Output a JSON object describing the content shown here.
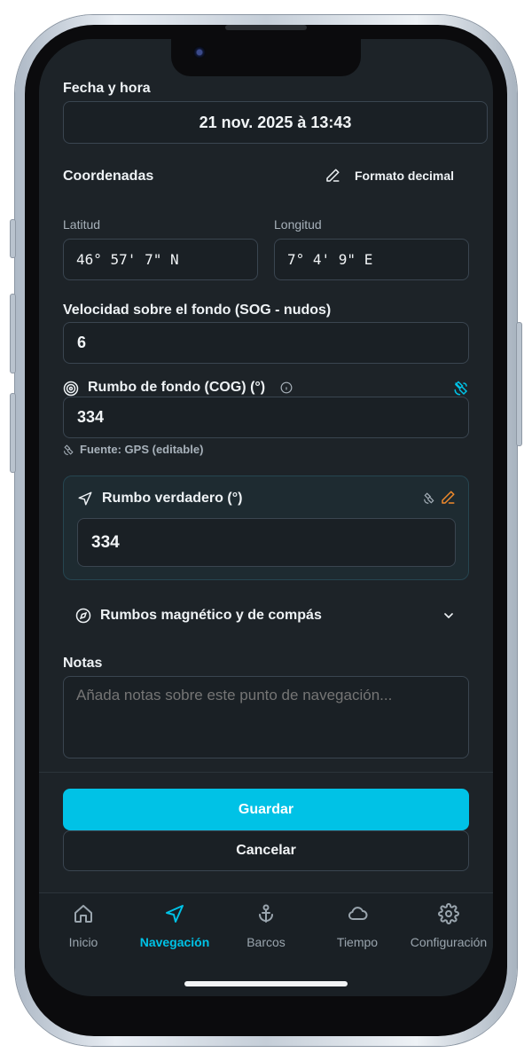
{
  "fecha": {
    "label": "Fecha y hora",
    "value": "21 nov. 2025 à 13:43"
  },
  "coords": {
    "label": "Coordenadas",
    "format_button": "Formato decimal",
    "lat_label": "Latitud",
    "lat_value": "46° 57' 7\" N",
    "lon_label": "Longitud",
    "lon_value": "7° 4' 9\" E"
  },
  "sog": {
    "label": "Velocidad sobre el fondo (SOG - nudos)",
    "value": "6"
  },
  "cog": {
    "label": "Rumbo de fondo (COG) (°)",
    "value": "334",
    "source": "Fuente: GPS (editable)"
  },
  "true_heading": {
    "label": "Rumbo verdadero (°)",
    "value": "334"
  },
  "magnetic": {
    "label": "Rumbos magnético y de compás"
  },
  "notes": {
    "label": "Notas",
    "placeholder": "Añada notas sobre este punto de navegación..."
  },
  "actions": {
    "save": "Guardar",
    "cancel": "Cancelar"
  },
  "bottom_nav": [
    {
      "label": "Inicio",
      "icon": "home-icon"
    },
    {
      "label": "Navegación",
      "icon": "navigation-icon",
      "active": true
    },
    {
      "label": "Barcos",
      "icon": "anchor-icon"
    },
    {
      "label": "Tiempo",
      "icon": "cloud-icon"
    },
    {
      "label": "Configuración",
      "icon": "gear-icon"
    }
  ],
  "colors": {
    "accent": "#00c2e6",
    "edit_orange": "#f08a2c",
    "background": "#1d2328",
    "card_bg": "#1e2b31"
  }
}
